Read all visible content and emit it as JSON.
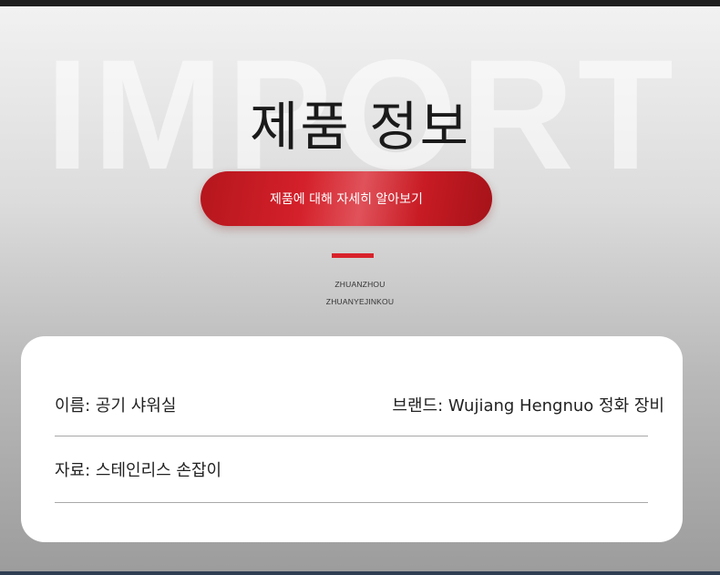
{
  "background_word": "IMPORT",
  "title": "제품 정보",
  "cta_label": "제품에 대해 자세히 알아보기",
  "subtitle_lines": [
    "ZHUANZHOU",
    "ZHUANYEJINKOU"
  ],
  "accent_color": "#d8222b",
  "fields": {
    "name": "이름: 공기 샤워실",
    "brand": "브랜드: Wujiang Hengnuo 정화 장비",
    "material": "자료: 스테인리스 손잡이"
  }
}
